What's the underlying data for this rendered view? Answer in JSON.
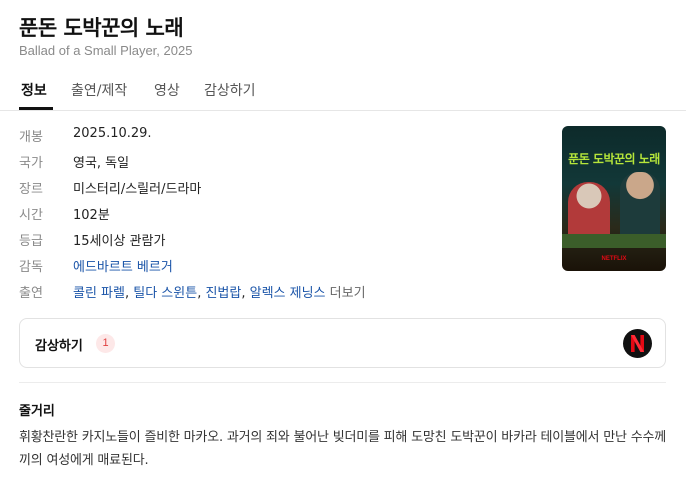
{
  "header": {
    "title": "푼돈 도박꾼의 노래",
    "subtitle": "Ballad of a Small Player, 2025"
  },
  "tabs": [
    {
      "label": "정보",
      "active": true
    },
    {
      "label": "출연/제작",
      "active": false
    },
    {
      "label": "영상",
      "active": false
    },
    {
      "label": "감상하기",
      "active": false
    }
  ],
  "info": {
    "release": {
      "key": "개봉",
      "value": "2025.10.29."
    },
    "country": {
      "key": "국가",
      "value": "영국, 독일"
    },
    "genre": {
      "key": "장르",
      "value": "미스터리/스릴러/드라마"
    },
    "runtime": {
      "key": "시간",
      "value": "102분"
    },
    "rating": {
      "key": "등급",
      "value": "15세이상 관람가"
    },
    "director": {
      "key": "감독",
      "value": "에드바르트 베르거"
    },
    "cast": {
      "key": "출연",
      "names": [
        "콜린 파렐",
        "틸다 스윈튼",
        "진법랍",
        "알렉스 제닝스"
      ],
      "separator": ", ",
      "more": "더보기"
    }
  },
  "poster": {
    "title": "푼돈 도박꾼의 노래",
    "brand": "NETFLIX"
  },
  "watch": {
    "label": "감상하기",
    "count": "1",
    "provider_icon": "netflix-icon",
    "provider_color": "#e50914"
  },
  "plot": {
    "heading": "줄거리",
    "text": "휘황찬란한 카지노들이 즐비한 마카오. 과거의 죄와 불어난 빚더미를 피해 도망친 도박꾼이 바카라 테이블에서 만난 수수께끼의 여성에게 매료된다."
  }
}
